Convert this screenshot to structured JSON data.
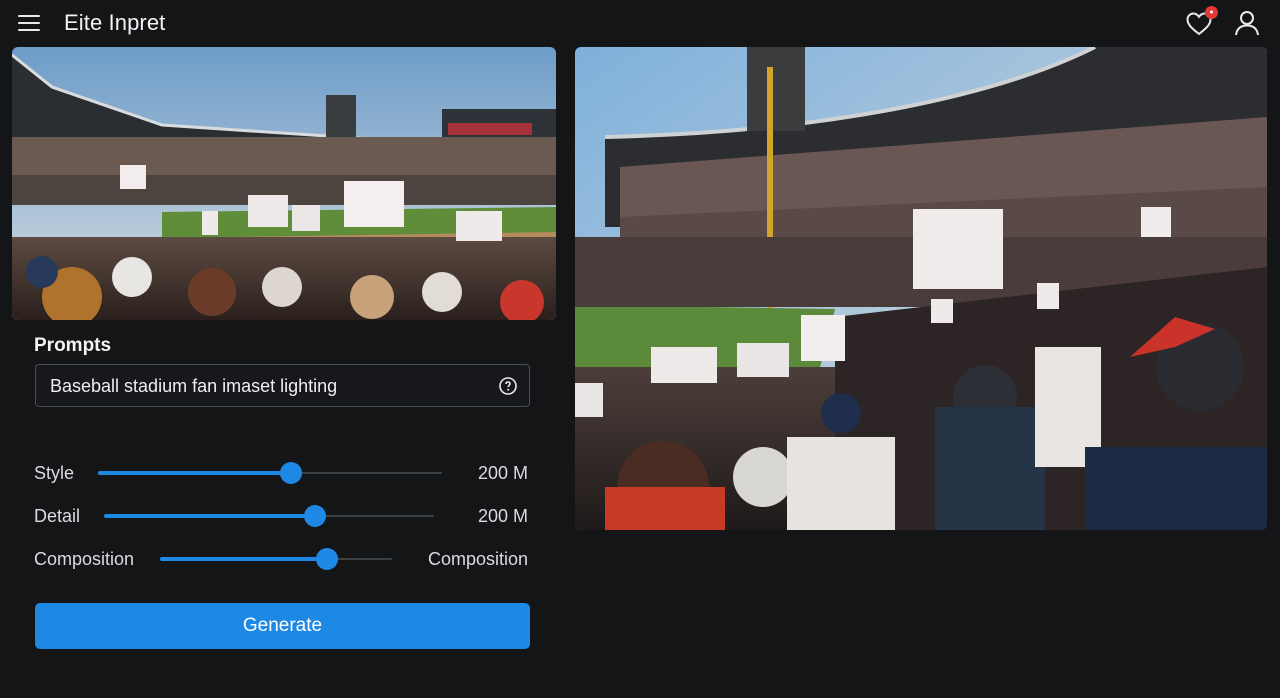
{
  "header": {
    "title": "Eite Inpret",
    "menu_icon": "hamburger-menu-icon",
    "favorites_icon": "heart-icon",
    "user_icon": "user-icon",
    "badge_color": "#e53935"
  },
  "images": [
    {
      "name": "generated-image-thumbnail",
      "subject": "baseball stadium crowd holding blank signs"
    },
    {
      "name": "generated-image-preview",
      "subject": "baseball stadium crowd holding signs near foul pole"
    }
  ],
  "prompts": {
    "label": "Prompts",
    "value": "Baseball stadium fan imaset lighting",
    "info_icon": "info-icon"
  },
  "sliders": [
    {
      "label": "Style",
      "value_text": "200 M",
      "level": 0.56
    },
    {
      "label": "Detail",
      "value_text": "200 M",
      "level": 0.64
    },
    {
      "label": "Composition",
      "value_text": "Composition",
      "level": 0.72
    }
  ],
  "generate": {
    "label": "Generate"
  },
  "colors": {
    "accent": "#1e88e5",
    "background": "#141517"
  }
}
